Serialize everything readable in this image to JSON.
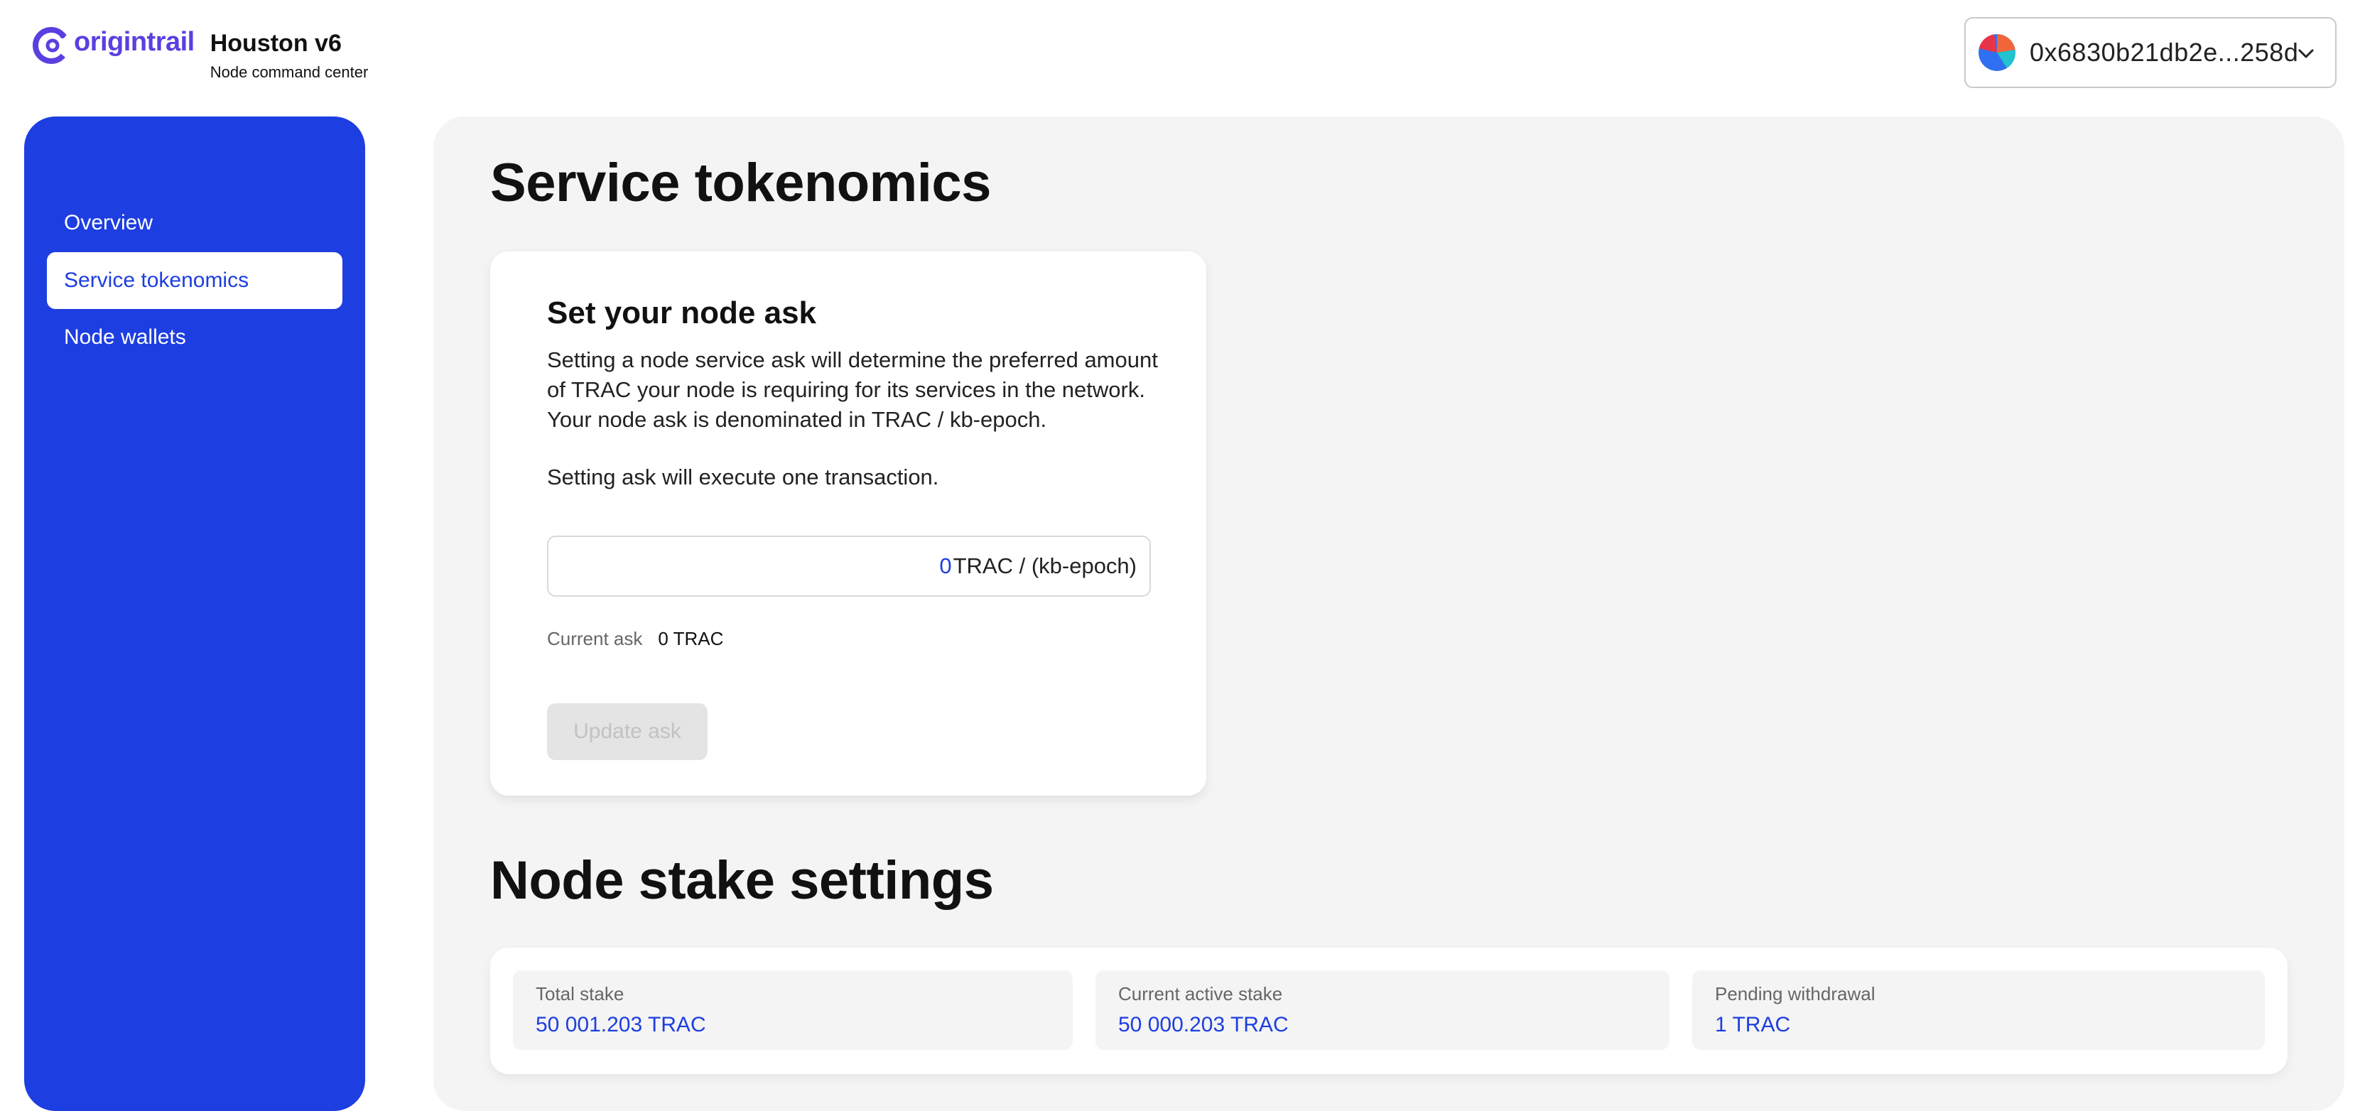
{
  "header": {
    "brand": "origintrail",
    "app_title": "Houston v6",
    "app_subtitle": "Node command center",
    "wallet_address": "0x6830b21db2e...258d"
  },
  "sidebar": {
    "items": [
      {
        "label": "Overview",
        "active": false
      },
      {
        "label": "Service tokenomics",
        "active": true
      },
      {
        "label": "Node wallets",
        "active": false
      }
    ]
  },
  "main": {
    "title": "Service tokenomics",
    "ask_card": {
      "title": "Set your node ask",
      "description": "Setting a node service ask will determine the preferred amount of TRAC your node is requiring for its services in the network. Your node ask is denominated in TRAC / kb-epoch.",
      "note": "Setting ask will execute one transaction.",
      "input_value": "0",
      "input_unit": "TRAC / (kb-epoch)",
      "current_label": "Current ask",
      "current_value": "0 TRAC",
      "button_label": "Update ask"
    },
    "stake_title": "Node stake settings",
    "stake": [
      {
        "label": "Total stake",
        "value": "50 001.203 TRAC"
      },
      {
        "label": "Current active stake",
        "value": "50 000.203 TRAC"
      },
      {
        "label": "Pending withdrawal",
        "value": "1 TRAC"
      }
    ]
  },
  "colors": {
    "accent": "#1d3ee0",
    "brand": "#5b3fe0",
    "panel_bg": "#f4f4f4"
  }
}
